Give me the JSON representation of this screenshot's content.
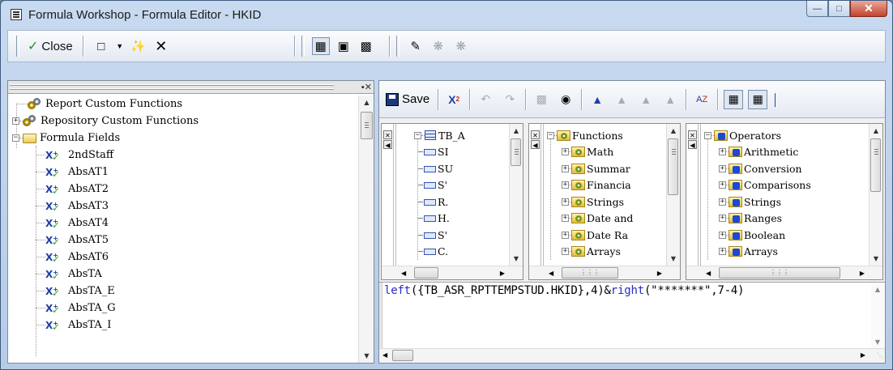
{
  "window": {
    "title": "Formula Workshop - Formula Editor - HKID"
  },
  "toolbar": {
    "close_label": "Close"
  },
  "left_tree": {
    "groups": [
      {
        "label": "Report Custom Functions",
        "expandable": false
      },
      {
        "label": "Repository Custom Functions",
        "expandable": true
      },
      {
        "label": "Formula Fields",
        "expandable": true,
        "expanded": true
      }
    ],
    "formulas": [
      "2ndStaff",
      "AbsAT1",
      "AbsAT2",
      "AbsAT3",
      "AbsAT4",
      "AbsAT5",
      "AbsAT6",
      "AbsTA",
      "AbsTA_E",
      "AbsTA_G",
      "AbsTA_I"
    ]
  },
  "editor_toolbar": {
    "save_label": "Save"
  },
  "fields_tree": {
    "table": "TB_A",
    "fields": [
      "SI",
      "SU",
      "S'",
      "R.",
      "H.",
      "S'",
      "C."
    ]
  },
  "functions_tree": {
    "root": "Functions",
    "items": [
      "Math",
      "Summar",
      "Financia",
      "Strings",
      "Date and",
      "Date Ra",
      "Arrays"
    ]
  },
  "operators_tree": {
    "root": "Operators",
    "items": [
      "Arithmetic",
      "Conversion",
      "Comparisons",
      "Strings",
      "Ranges",
      "Boolean",
      "Arrays"
    ]
  },
  "code": {
    "fn1": "left",
    "part1": "({TB_ASR_RPTTEMPSTUD.HKID},4)&",
    "fn2": "right",
    "part2": "(\"*******\",7-4)"
  },
  "colors": {
    "keyword": "#2a2ac8",
    "close_button": "#c4422b"
  }
}
